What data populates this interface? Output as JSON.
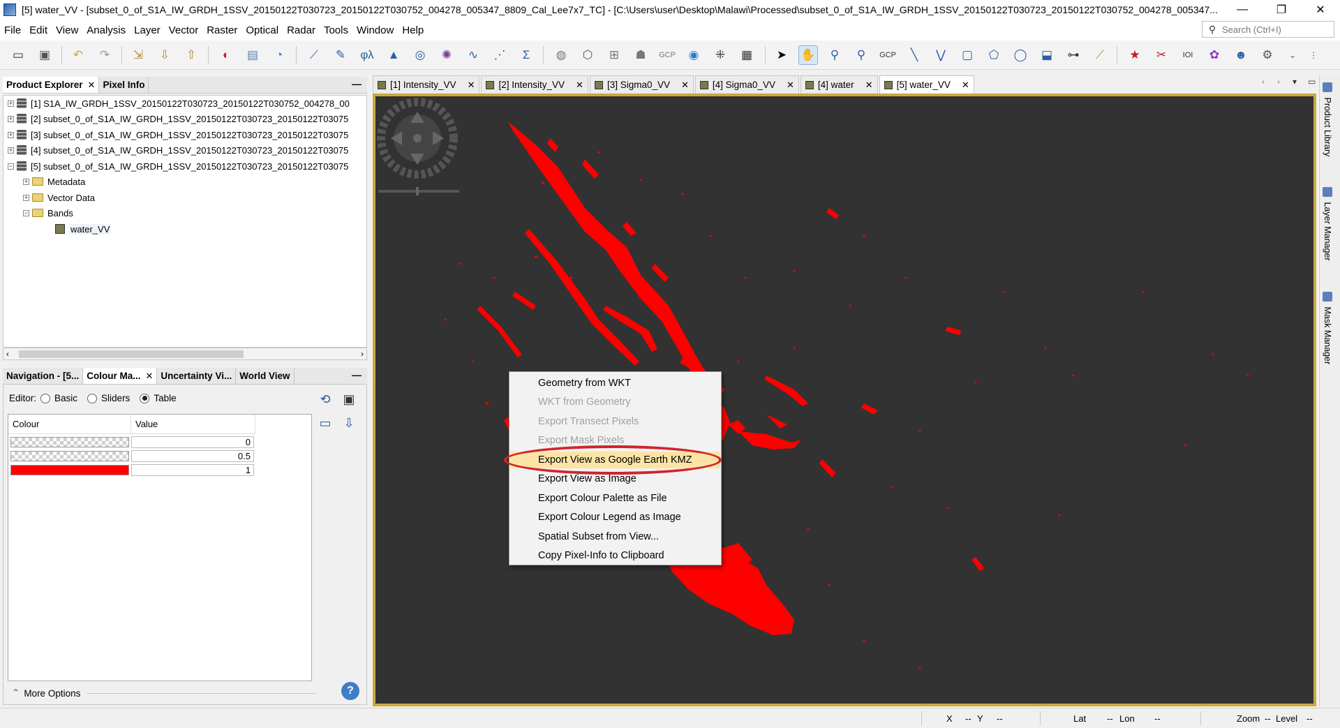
{
  "window": {
    "title": "[5] water_VV - [subset_0_of_S1A_IW_GRDH_1SSV_20150122T030723_20150122T030752_004278_005347_8809_Cal_Lee7x7_TC] - [C:\\Users\\user\\Desktop\\Malawi\\Processed\\subset_0_of_S1A_IW_GRDH_1SSV_20150122T030723_20150122T030752_004278_005347...",
    "minimize": "—",
    "restore": "❐",
    "close": "✕"
  },
  "menu": [
    "File",
    "Edit",
    "View",
    "Analysis",
    "Layer",
    "Vector",
    "Raster",
    "Optical",
    "Radar",
    "Tools",
    "Window",
    "Help"
  ],
  "search": {
    "placeholder": "Search (Ctrl+I)",
    "icon": "search-icon"
  },
  "product_explorer": {
    "tabs": [
      {
        "label": "Product Explorer",
        "close": "✕"
      },
      {
        "label": "Pixel Info"
      }
    ],
    "minimize": "—",
    "products": [
      "[1] S1A_IW_GRDH_1SSV_20150122T030723_20150122T030752_004278_00",
      "[2] subset_0_of_S1A_IW_GRDH_1SSV_20150122T030723_20150122T03075",
      "[3] subset_0_of_S1A_IW_GRDH_1SSV_20150122T030723_20150122T03075",
      "[4] subset_0_of_S1A_IW_GRDH_1SSV_20150122T030723_20150122T03075",
      "[5] subset_0_of_S1A_IW_GRDH_1SSV_20150122T030723_20150122T03075"
    ],
    "nodes": [
      "Metadata",
      "Vector Data",
      "Bands"
    ],
    "band": "water_VV"
  },
  "lower_panel": {
    "tabs": [
      {
        "label": "Navigation - [5..."
      },
      {
        "label": "Colour Ma...",
        "close": "✕"
      },
      {
        "label": "Uncertainty Vi..."
      },
      {
        "label": "World View"
      }
    ],
    "minimize": "—",
    "editor_label": "Editor:",
    "editor_options": [
      "Basic",
      "Sliders",
      "Table"
    ],
    "editor_selected": "Table",
    "table_headers": [
      "Colour",
      "Value"
    ],
    "rows": [
      {
        "colour": "transparent",
        "value": "0"
      },
      {
        "colour": "transparent",
        "value": "0.5"
      },
      {
        "colour": "#ff0000",
        "value": "1"
      }
    ],
    "more_options": "More Options",
    "help": "?"
  },
  "view_tabs": [
    {
      "label": "[1] Intensity_VV"
    },
    {
      "label": "[2] Intensity_VV"
    },
    {
      "label": "[3] Sigma0_VV"
    },
    {
      "label": "[4] Sigma0_VV"
    },
    {
      "label": "[4] water"
    },
    {
      "label": "[5] water_VV",
      "active": true
    }
  ],
  "tab_close": "✕",
  "right_tabs": [
    "Product Library",
    "Layer Manager",
    "Mask Manager"
  ],
  "context_menu": {
    "items": [
      {
        "label": "Geometry from WKT",
        "enabled": true
      },
      {
        "label": "WKT from Geometry",
        "enabled": false
      },
      {
        "label": "Export Transect Pixels",
        "enabled": false
      },
      {
        "label": "Export Mask Pixels",
        "enabled": false
      },
      {
        "label": "Export View as Google Earth KMZ",
        "enabled": true,
        "highlighted": true
      },
      {
        "label": "Export View as Image",
        "enabled": true
      },
      {
        "label": "Export Colour Palette as File",
        "enabled": true
      },
      {
        "label": "Export Colour Legend as Image",
        "enabled": true
      },
      {
        "label": "Spatial Subset from View...",
        "enabled": true
      },
      {
        "label": "Copy Pixel-Info to Clipboard",
        "enabled": true
      }
    ]
  },
  "status": {
    "x_label": "X",
    "x_val": "--",
    "y_label": "Y",
    "y_val": "--",
    "lat_label": "Lat",
    "lat_val": "--",
    "lon_label": "Lon",
    "lon_val": "--",
    "zoom_label": "Zoom",
    "zoom_val": "--",
    "level_label": "Level",
    "level_val": "--"
  },
  "colors": {
    "water": "#ff0000",
    "canvas_bg": "#323232",
    "view_border": "#c8a93e",
    "highlight_ring": "#d2232a",
    "menu_highlight": "#fbe4a6"
  }
}
